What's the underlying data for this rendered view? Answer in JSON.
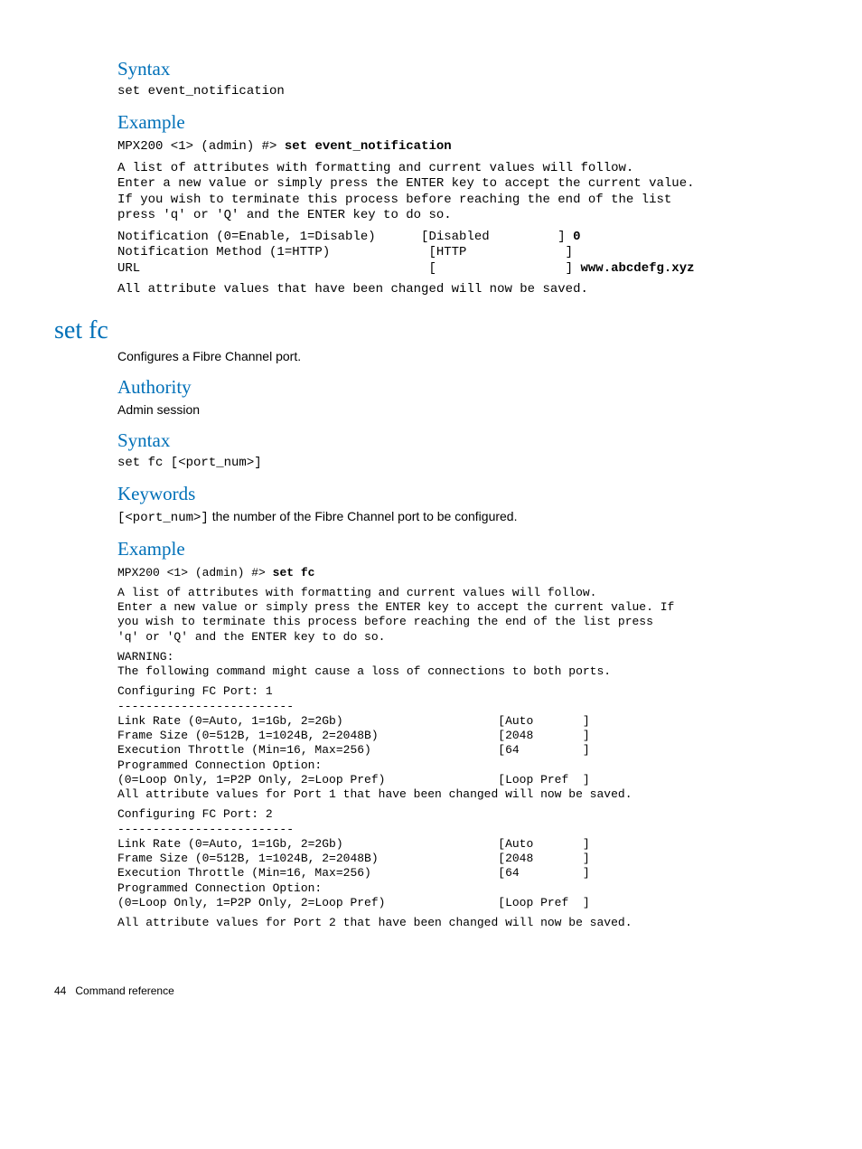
{
  "sec1": {
    "h_syntax": "Syntax",
    "syntax_code": "set event_notification",
    "h_example": "Example",
    "ex_prompt": "MPX200 <1> (admin) #> ",
    "ex_cmd": "set event_notification",
    "ex_intro": "A list of attributes with formatting and current values will follow.\nEnter a new value or simply press the ENTER key to accept the current value.\nIf you wish to terminate this process before reaching the end of the list\npress 'q' or 'Q' and the ENTER key to do so.",
    "ex_row1_label": "Notification (0=Enable, 1=Disable)      [Disabled         ] ",
    "ex_row1_bold": "0",
    "ex_row2": "Notification Method (1=HTTP)             [HTTP             ]",
    "ex_row3_label": "URL                                      [                 ] ",
    "ex_row3_bold": "www.abcdefg.xyz",
    "ex_saved": "All attribute values that have been changed will now be saved."
  },
  "setfc": {
    "title": "set fc",
    "desc": "Configures a Fibre Channel port.",
    "h_authority": "Authority",
    "authority_text": "Admin session",
    "h_syntax": "Syntax",
    "syntax_code": "set fc [<port_num>]",
    "h_keywords": "Keywords",
    "kw_code": "[<port_num>]",
    "kw_text": " the number of the Fibre Channel port to be configured.",
    "h_example": "Example",
    "ex_prompt": "MPX200 <1> (admin) #> ",
    "ex_cmd": "set fc",
    "ex_intro": "A list of attributes with formatting and current values will follow.\nEnter a new value or simply press the ENTER key to accept the current value. If\nyou wish to terminate this process before reaching the end of the list press\n'q' or 'Q' and the ENTER key to do so.",
    "ex_warning": "WARNING:\nThe following command might cause a loss of connections to both ports.",
    "ex_port1": "Configuring FC Port: 1\n-------------------------\nLink Rate (0=Auto, 1=1Gb, 2=2Gb)                      [Auto       ]\nFrame Size (0=512B, 1=1024B, 2=2048B)                 [2048       ]\nExecution Throttle (Min=16, Max=256)                  [64         ]\nProgrammed Connection Option:\n(0=Loop Only, 1=P2P Only, 2=Loop Pref)                [Loop Pref  ]\nAll attribute values for Port 1 that have been changed will now be saved.",
    "ex_port2": "Configuring FC Port: 2\n-------------------------\nLink Rate (0=Auto, 1=1Gb, 2=2Gb)                      [Auto       ]\nFrame Size (0=512B, 1=1024B, 2=2048B)                 [2048       ]\nExecution Throttle (Min=16, Max=256)                  [64         ]\nProgrammed Connection Option:\n(0=Loop Only, 1=P2P Only, 2=Loop Pref)                [Loop Pref  ]",
    "ex_saved2": "All attribute values for Port 2 that have been changed will now be saved."
  },
  "footer": {
    "page": "44",
    "title": "Command reference"
  }
}
